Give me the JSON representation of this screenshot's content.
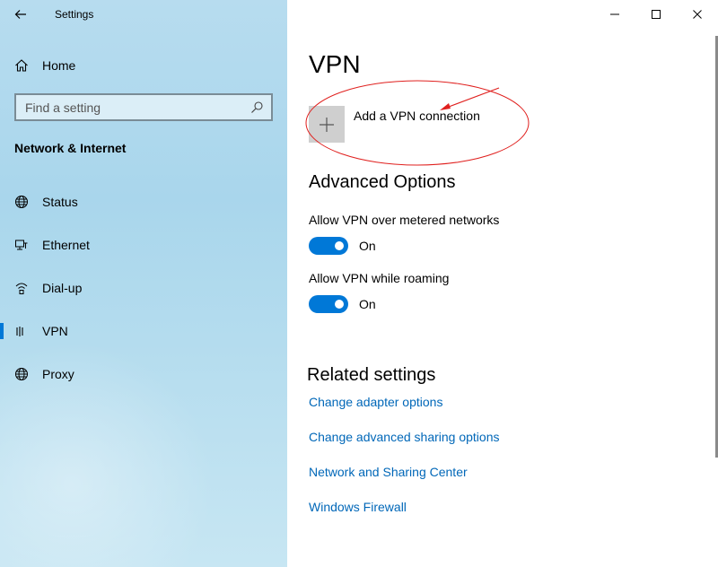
{
  "window": {
    "title": "Settings",
    "controls": [
      "minimize-icon",
      "maximize-icon",
      "close-icon"
    ]
  },
  "sidebar": {
    "home_label": "Home",
    "search": {
      "placeholder": "Find a setting"
    },
    "section_title": "Network & Internet",
    "items": [
      {
        "label": "Status",
        "icon": "globe-icon",
        "selected": false
      },
      {
        "label": "Ethernet",
        "icon": "ethernet-icon",
        "selected": false
      },
      {
        "label": "Dial-up",
        "icon": "dialup-icon",
        "selected": false
      },
      {
        "label": "VPN",
        "icon": "vpn-icon",
        "selected": true
      },
      {
        "label": "Proxy",
        "icon": "globe-icon",
        "selected": false
      }
    ]
  },
  "main": {
    "title": "VPN",
    "add_vpn_label": "Add a VPN connection",
    "advanced": {
      "title": "Advanced Options",
      "options": [
        {
          "label": "Allow VPN over metered networks",
          "state": "On"
        },
        {
          "label": "Allow VPN while roaming",
          "state": "On"
        }
      ]
    },
    "related": {
      "title": "Related settings",
      "links": [
        "Change adapter options",
        "Change advanced sharing options",
        "Network and Sharing Center",
        "Windows Firewall"
      ]
    }
  },
  "colors": {
    "accent": "#0078d7",
    "link": "#0067b8",
    "annotation": "#e0201e"
  }
}
